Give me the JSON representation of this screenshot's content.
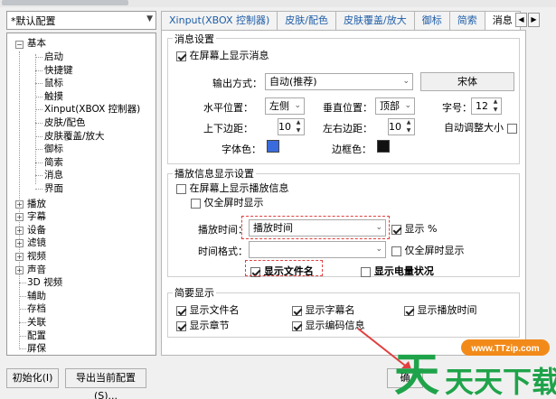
{
  "profile": {
    "selected": "*默认配置"
  },
  "tree": {
    "root": "基本",
    "children": [
      "启动",
      "快捷键",
      "鼠标",
      "触摸",
      "Xinput(XBOX 控制器)",
      "皮肤/配色",
      "皮肤覆盖/放大",
      "御标",
      "简索",
      "消息",
      "界面"
    ],
    "collapsed": [
      "播放",
      "字幕",
      "设备",
      "滤镜",
      "视频",
      "声音"
    ],
    "leaves": [
      "3D 视频",
      "辅助",
      "存档",
      "关联",
      "配置",
      "屏保"
    ]
  },
  "tabs": [
    "Xinput(XBOX 控制器)",
    "皮肤/配色",
    "皮肤覆盖/放大",
    "御标",
    "简索",
    "消息"
  ],
  "active_tab": "消息",
  "message_settings": {
    "title": "消息设置",
    "show_on_screen": "在屏幕上显示消息",
    "output_label": "输出方式：",
    "output_value": "自动(推荐)",
    "font_button": "宋体",
    "hpos_label": "水平位置：",
    "hpos_value": "左侧",
    "vpos_label": "垂直位置：",
    "vpos_value": "顶部",
    "size_label": "字号：",
    "size_value": "12",
    "tb_margin_label": "上下边距：",
    "tb_margin_value": "10",
    "lr_margin_label": "左右边距：",
    "lr_margin_value": "10",
    "auto_size_label": "自动调整大小",
    "font_color_label": "字体色：",
    "border_color_label": "边框色：",
    "font_color": "#3a6bdc",
    "border_color": "#111111"
  },
  "play_info": {
    "title": "播放信息显示设置",
    "show_on_screen": "在屏幕上显示播放信息",
    "fullscreen_only": "仅全屏时显示",
    "play_time_label": "播放时间：",
    "play_time_value": "播放时间",
    "show_percent": "显示 %",
    "time_format_label": "时间格式：",
    "time_format_value": "",
    "fullscreen_only2": "仅全屏时显示",
    "show_filename": "显示文件名",
    "show_battery": "显示电量状况"
  },
  "brief": {
    "title": "简要显示",
    "items": [
      "显示文件名",
      "显示字幕名",
      "显示播放时间",
      "显示章节",
      "显示编码信息"
    ]
  },
  "bottom": {
    "init": "初始化(I)",
    "export": "导出当前配置(S)...",
    "ok": "确"
  },
  "watermark": {
    "url": "www.TTzip.com",
    "text": "天天下载"
  },
  "colors": {
    "accent": "#1f5ea8",
    "red_annotation": "#e04040",
    "wm_green": "#1fa34a",
    "wm_orange": "#f28a1a"
  }
}
